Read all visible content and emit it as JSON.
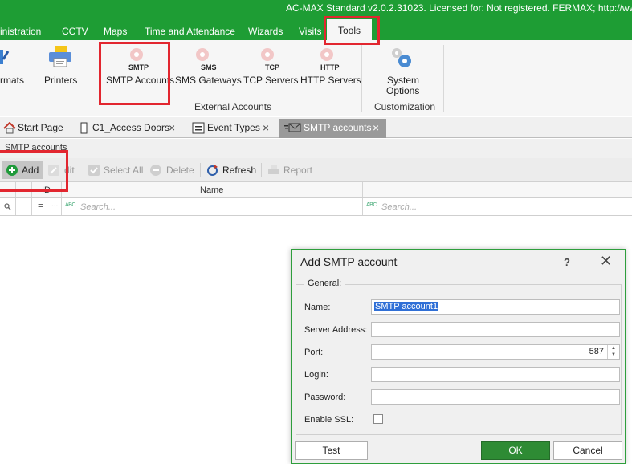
{
  "window": {
    "title": "AC-MAX Standard v2.0.2.31023. Licensed for: Not registered. FERMAX; http://www.ferm"
  },
  "ribbon_tabs": [
    "inistration",
    "CCTV",
    "Maps",
    "Time and Attendance",
    "Wizards",
    "Visits",
    "Tools"
  ],
  "ribbon": {
    "formats_label": "rmats",
    "printers_label": "Printers",
    "smtp_cap": "SMTP",
    "smtp_label": "SMTP Accounts",
    "sms_cap": "SMS",
    "sms_label": "SMS Gateways",
    "tcp_cap": "TCP",
    "tcp_label": "TCP Servers",
    "http_cap": "HTTP",
    "http_label": "HTTP Servers",
    "sysopt_label1": "System",
    "sysopt_label2": "Options",
    "group_external": "External Accounts",
    "group_custom": "Customization"
  },
  "doc_tabs": [
    {
      "label": "Start Page"
    },
    {
      "label": "C1_Access Doors"
    },
    {
      "label": "Event Types"
    },
    {
      "label": "SMTP accounts"
    }
  ],
  "panel_caption": "SMTP accounts",
  "toolbar": {
    "add": "Add",
    "edit": "dit",
    "select_all": "Select All",
    "delete": "Delete",
    "refresh": "Refresh",
    "report": "Report"
  },
  "grid": {
    "col_id": "ID",
    "col_name": "Name",
    "search_placeholder": "Search...",
    "filter_eq": "=",
    "filter_dots": "..."
  },
  "dialog": {
    "title": "Add SMTP account",
    "help": "?",
    "close": "✕",
    "group": "General:",
    "name_label": "Name:",
    "name_value": "SMTP account1",
    "server_label": "Server Address:",
    "server_value": "",
    "port_label": "Port:",
    "port_value": "587",
    "login_label": "Login:",
    "login_value": "",
    "password_label": "Password:",
    "password_value": "",
    "ssl_label": "Enable SSL:",
    "test_button": "Test",
    "ok_button": "OK",
    "cancel_button": "Cancel"
  },
  "colors": {
    "brand_green": "#1e9d34",
    "highlight_red": "#e2262f",
    "ok_green": "#2e8b34"
  }
}
